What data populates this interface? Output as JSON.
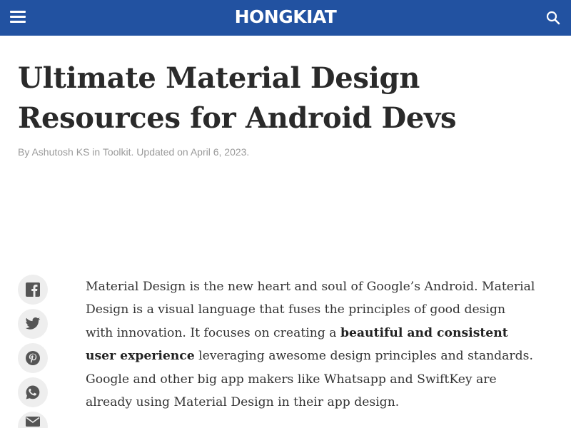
{
  "header": {
    "brand": "HONGKIAT",
    "background_color": "#2252a1",
    "menu_icon": "hamburger-icon",
    "search_icon": "search-icon"
  },
  "article": {
    "title": "Ultimate Material Design Resources for Android Devs",
    "meta": {
      "prefix": "By ",
      "author": "Ashutosh KS",
      "in": " in ",
      "category": "Toolkit",
      "updated": ". Updated on April 6, 2023."
    },
    "body": {
      "part1": "Material Design is the new heart and soul of Google’s Android. Material Design is a visual language that fuses the principles of good design with innovation. It focuses on creating a ",
      "bold": "beautiful and consistent user experience",
      "part2": " leveraging awesome design principles and standards. Google and other big app makers like Whatsapp and SwiftKey are already using Material Design in their app design."
    }
  },
  "share": [
    {
      "icon": "facebook-icon"
    },
    {
      "icon": "twitter-icon"
    },
    {
      "icon": "pinterest-icon"
    },
    {
      "icon": "whatsapp-icon"
    },
    {
      "icon": "email-icon"
    }
  ]
}
